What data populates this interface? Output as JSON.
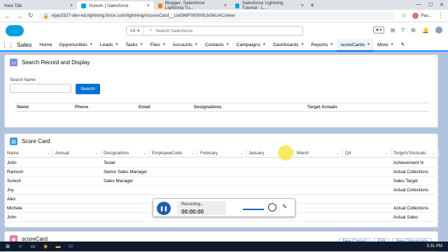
{
  "browser": {
    "tabs": [
      {
        "label": "New Tab",
        "color": "#dee1e6"
      },
      {
        "label": "Suresh | Salesforce",
        "color": "#00a1e0"
      },
      {
        "label": "Blogger: Salesforce Lightning Tu...",
        "color": "#f57d00"
      },
      {
        "label": "Salesforce Lightning Tutorial - L...",
        "color": "#00a1e0"
      }
    ],
    "url": "vijay3327-dev-ed.lightning.force.com/lightning/r/scoreCard__c/a086F00000bJx5kUAC/view",
    "profile": "Pau..."
  },
  "sf": {
    "search_scope": "All",
    "search_placeholder": "Search Salesforce",
    "app_name": "Sales",
    "nav_items": [
      {
        "label": "Home",
        "chev": false
      },
      {
        "label": "Opportunities",
        "chev": true
      },
      {
        "label": "Leads",
        "chev": true
      },
      {
        "label": "Tasks",
        "chev": true
      },
      {
        "label": "Files",
        "chev": true
      },
      {
        "label": "Accounts",
        "chev": true
      },
      {
        "label": "Contacts",
        "chev": true
      },
      {
        "label": "Campaigns",
        "chev": true
      },
      {
        "label": "Dashboards",
        "chev": true
      },
      {
        "label": "Reports",
        "chev": true
      },
      {
        "label": "scoreCards",
        "chev": true
      },
      {
        "label": "More",
        "chev": true
      }
    ],
    "active_nav": "scoreCards"
  },
  "search_card": {
    "title": "Search Record and Display",
    "field_label": "Search Name",
    "button": "Search",
    "columns": [
      "Name",
      "Phone",
      "Email",
      "Designations",
      "Target Actuals"
    ]
  },
  "score_card": {
    "title": "Score Card",
    "columns": [
      "Name",
      "Annual",
      "Designations",
      "EmployeeCode",
      "February",
      "January",
      "March",
      "Q4",
      "TargetVSActuals"
    ],
    "rows": [
      [
        "John",
        "",
        "Tester",
        "",
        "",
        "",
        "",
        "",
        "Achievement %"
      ],
      [
        "Ramesh",
        "",
        "Senior Sales Manager",
        "",
        "",
        "",
        "",
        "",
        "Actual Collections"
      ],
      [
        "Suresh",
        "",
        "Sales Manager",
        "",
        "",
        "",
        "",
        "",
        "Sales Target"
      ],
      [
        "Joy",
        "",
        "",
        "",
        "",
        "",
        "",
        "",
        "Actual Collections"
      ],
      [
        "Alex",
        "",
        "",
        "",
        "",
        "",
        "",
        "",
        ""
      ],
      [
        "Michele",
        "",
        "",
        "",
        "",
        "",
        "",
        "",
        "Actual Collections"
      ],
      [
        "John",
        "",
        "",
        "",
        "",
        "",
        "",
        "",
        "Actual Sales"
      ]
    ]
  },
  "bottom_card": {
    "title": "scoreCard",
    "buttons": [
      "New Contact",
      "Edit",
      "New Opportunity"
    ]
  },
  "recorder": {
    "status": "Recording...",
    "time": "00:00:00"
  },
  "taskbar": {
    "clock": "5:31 PM"
  },
  "colors": {
    "brand": "#00a1e0",
    "button": "#0070d2",
    "background": "#b0c4df"
  }
}
